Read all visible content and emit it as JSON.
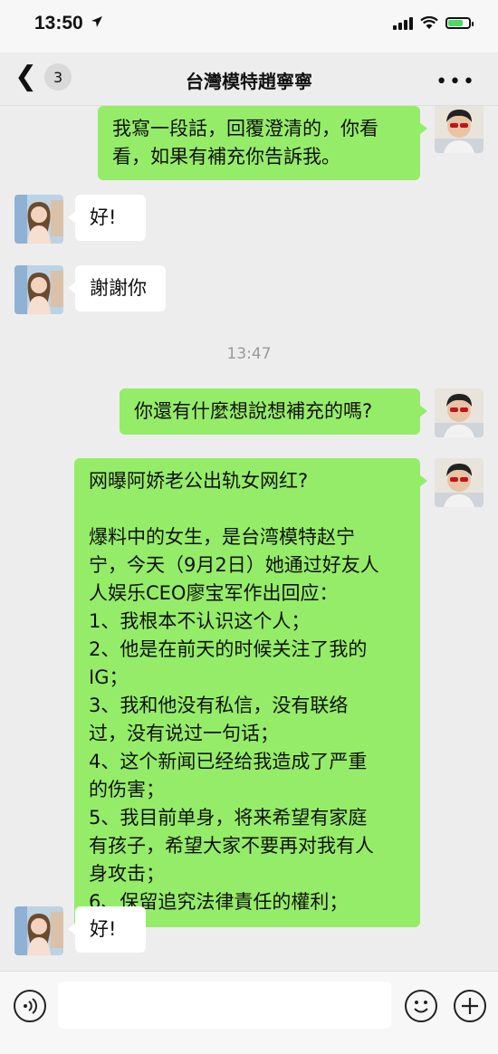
{
  "status_bar": {
    "time": "13:50",
    "location_arrow": "location-arrow-icon"
  },
  "nav": {
    "back_badge": "3",
    "title": "台灣模特趙寧寧",
    "more": "•••"
  },
  "messages": [
    {
      "side": "right",
      "text": "我寫一段話，回覆澄清的，你看\n看，如果有補充你告訴我。"
    },
    {
      "side": "left",
      "text": "好!"
    },
    {
      "side": "left",
      "text": "謝謝你"
    },
    {
      "side": "right",
      "text": "你還有什麼想說想補充的嗎?"
    },
    {
      "side": "right",
      "text": "网曝阿娇老公出轨女网红?\n\n爆料中的女生，是台湾模特赵宁\n宁，今天（9月2日）她通过好友人\n人娱乐CEO廖宝军作出回应：\n1、我根本不认识这个人；\n2、他是在前天的时候关注了我的\nIG；\n3、我和他没有私信，没有联络\n过，没有说过一句话；\n4、这个新闻已经给我造成了严重\n的伤害；\n5、我目前单身，将来希望有家庭\n有孩子，希望大家不要再对我有人\n身攻击；\n6、保留追究法律責任的權利；"
    },
    {
      "side": "left",
      "text": "好!"
    }
  ],
  "timestamp": "13:47",
  "input_bar": {
    "placeholder": ""
  },
  "colors": {
    "right_bubble": "#95ec69",
    "left_bubble": "#ffffff",
    "background": "#ededed"
  }
}
